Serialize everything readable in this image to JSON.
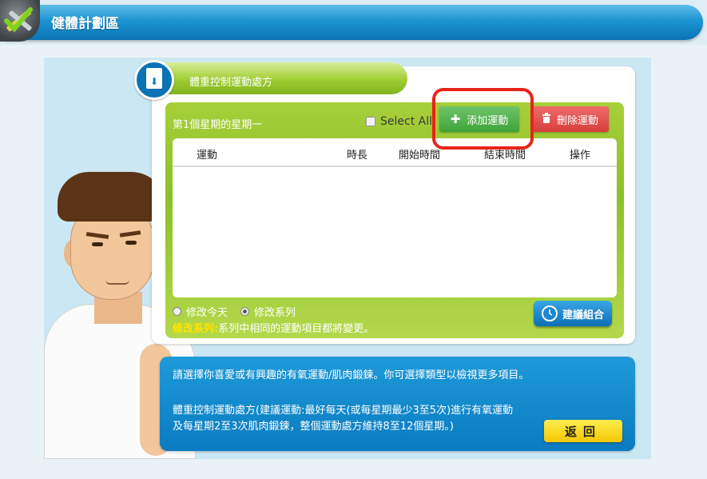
{
  "header": {
    "title": "健體計劃區",
    "icon": "tools-icon"
  },
  "panel": {
    "tab_label": "體重控制運動處方",
    "week_label": "第1個星期的星期一",
    "select_all_label": "Select All",
    "add_button_label": "添加運動",
    "delete_button_label": "刪除運動",
    "table": {
      "columns": [
        "運動",
        "時長",
        "開始時間",
        "結束時間",
        "操作"
      ],
      "rows": []
    },
    "edit_options": [
      {
        "label": "修改今天",
        "selected": false
      },
      {
        "label": "修改系列",
        "selected": true
      }
    ],
    "note_highlight": "修改系列:",
    "note_text": "系列中相同的運動項目都將變更。",
    "suggest_button_label": "建議組合"
  },
  "info": {
    "line1": "請選擇你喜愛或有興趣的有氧運動/肌肉鍛鍊。你可選擇類型以檢視更多項目。",
    "line2": "體重控制運動處方(建議運動:最好每天(或每星期最少3至5次)進行有氧運動",
    "line3": "及每星期2至3次肌肉鍛鍊，整個運動處方維持8至12個星期。)",
    "back_button_label": "返回"
  },
  "colors": {
    "header_blue": "#1c94d2",
    "panel_green": "#8cc02a",
    "add_green": "#3ea339",
    "delete_red": "#d93e3e",
    "back_yellow": "#f2c800",
    "highlight_red": "#e82418"
  }
}
